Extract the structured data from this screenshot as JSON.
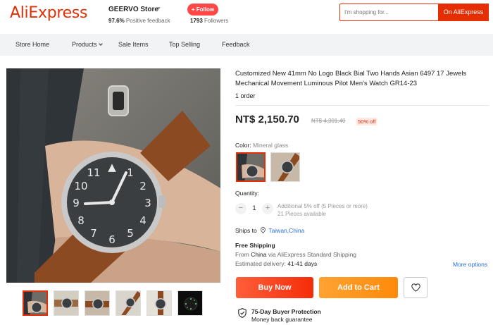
{
  "header": {
    "logo_text": "AliExpress",
    "store_name": "GEERVO Store",
    "positive_feedback_value": "97.6%",
    "positive_feedback_label": "Positive feedback",
    "follow_label": "+ Follow",
    "followers_count": "1793",
    "followers_label": "Followers",
    "search_placeholder": "I'm shopping for...",
    "search_button": "On AliExpress"
  },
  "nav": {
    "items": [
      {
        "label": "Store Home"
      },
      {
        "label": "Products"
      },
      {
        "label": "Sale Items"
      },
      {
        "label": "Top Selling"
      },
      {
        "label": "Feedback"
      }
    ]
  },
  "gallery": {
    "thumbnail_count": 6,
    "selected_index": 0
  },
  "product": {
    "title": "Customized New 41mm No Logo Black Bial Two Hands Asian 6497 17 Jewels Mechanical Movement Luminous Pilot Men's Watch GR14-23",
    "orders": "1 order",
    "price": "NT$ 2,150.70",
    "original_price": "NT$ 4,301.40",
    "discount": "50% off",
    "color_label": "Color:",
    "color_value": "Mineral glass",
    "quantity_label": "Quantity:",
    "quantity_value": "1",
    "quantity_minus": "−",
    "quantity_plus": "+",
    "bulk_discount": "Additional 5% off (5 Pieces or more)",
    "available": "21 Pieces available",
    "ships_to_label": "Ships to",
    "ships_to_location": "Taiwan,China",
    "free_shipping": "Free Shipping",
    "ship_from_prefix": "From",
    "ship_from_country": "China",
    "ship_from_suffix": "via AliExpress Standard Shipping",
    "estimated_delivery_label": "Estimated delivery:",
    "estimated_delivery_value": "41-41 days",
    "more_options": "More options",
    "buy_now": "Buy Now",
    "add_to_cart": "Add to Cart",
    "protection_title": "75-Day Buyer Protection",
    "protection_sub": "Money back guarantee"
  },
  "colors": {
    "brand": "#e62e04",
    "buy_now": "#f42d09",
    "add_to_cart": "#ff8a0a",
    "link": "#2b6dd6"
  }
}
